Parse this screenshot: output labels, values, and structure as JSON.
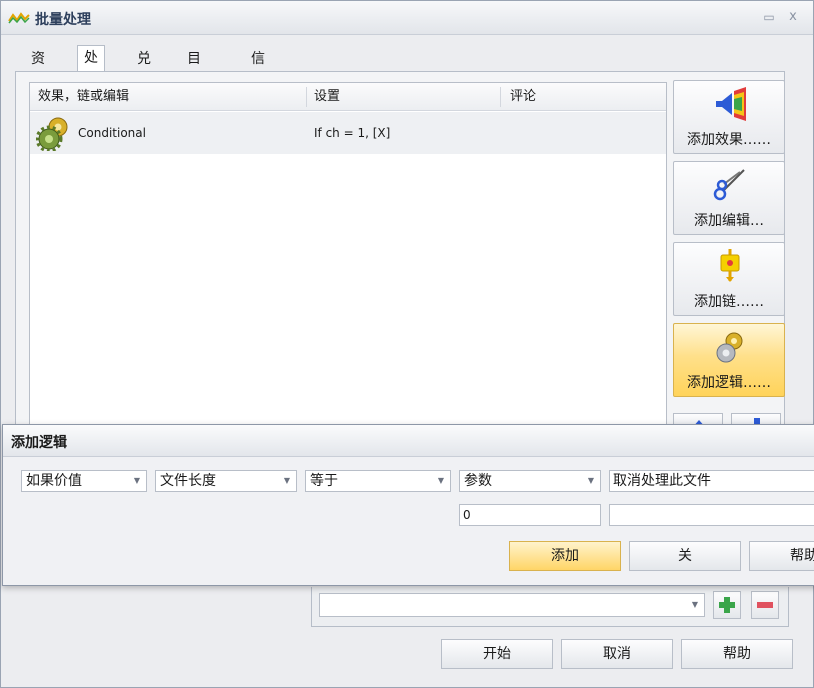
{
  "window": {
    "title": "批量处理",
    "minimize_glyph": "▭",
    "close_glyph": "x"
  },
  "tabs": [
    {
      "label": "资源"
    },
    {
      "label": "处理"
    },
    {
      "label": "兑换"
    },
    {
      "label": "目的地"
    },
    {
      "label": "信息"
    }
  ],
  "list": {
    "columns": [
      "效果，链或编辑",
      "设置",
      "评论"
    ],
    "rows": [
      {
        "icon": "gear-icon",
        "name": "Conditional",
        "settings": "If ch = 1, [X]",
        "comment": ""
      }
    ]
  },
  "side_buttons": {
    "add_effect": "添加效果……",
    "add_edit": "添加编辑…",
    "add_chain": "添加链……",
    "add_logic": "添加逻辑……"
  },
  "dialog": {
    "title": "添加逻辑",
    "condition": "如果价值",
    "field": "文件长度",
    "operator": "等于",
    "operand": "参数",
    "action": "取消处理此文件",
    "value": "0",
    "extra_value": "",
    "add_button": "添加",
    "close_button": "关",
    "help_button": "帮助"
  },
  "lower": {
    "combo_value": "",
    "add_icon": "plus-icon",
    "remove_icon": "minus-icon"
  },
  "footer": {
    "start": "开始",
    "cancel": "取消",
    "help": "帮助"
  },
  "colors": {
    "accent_highlight": "#ffd35a",
    "title_text": "#2d3f5c",
    "plus_green": "#3aa54a",
    "minus_red": "#e05260"
  }
}
